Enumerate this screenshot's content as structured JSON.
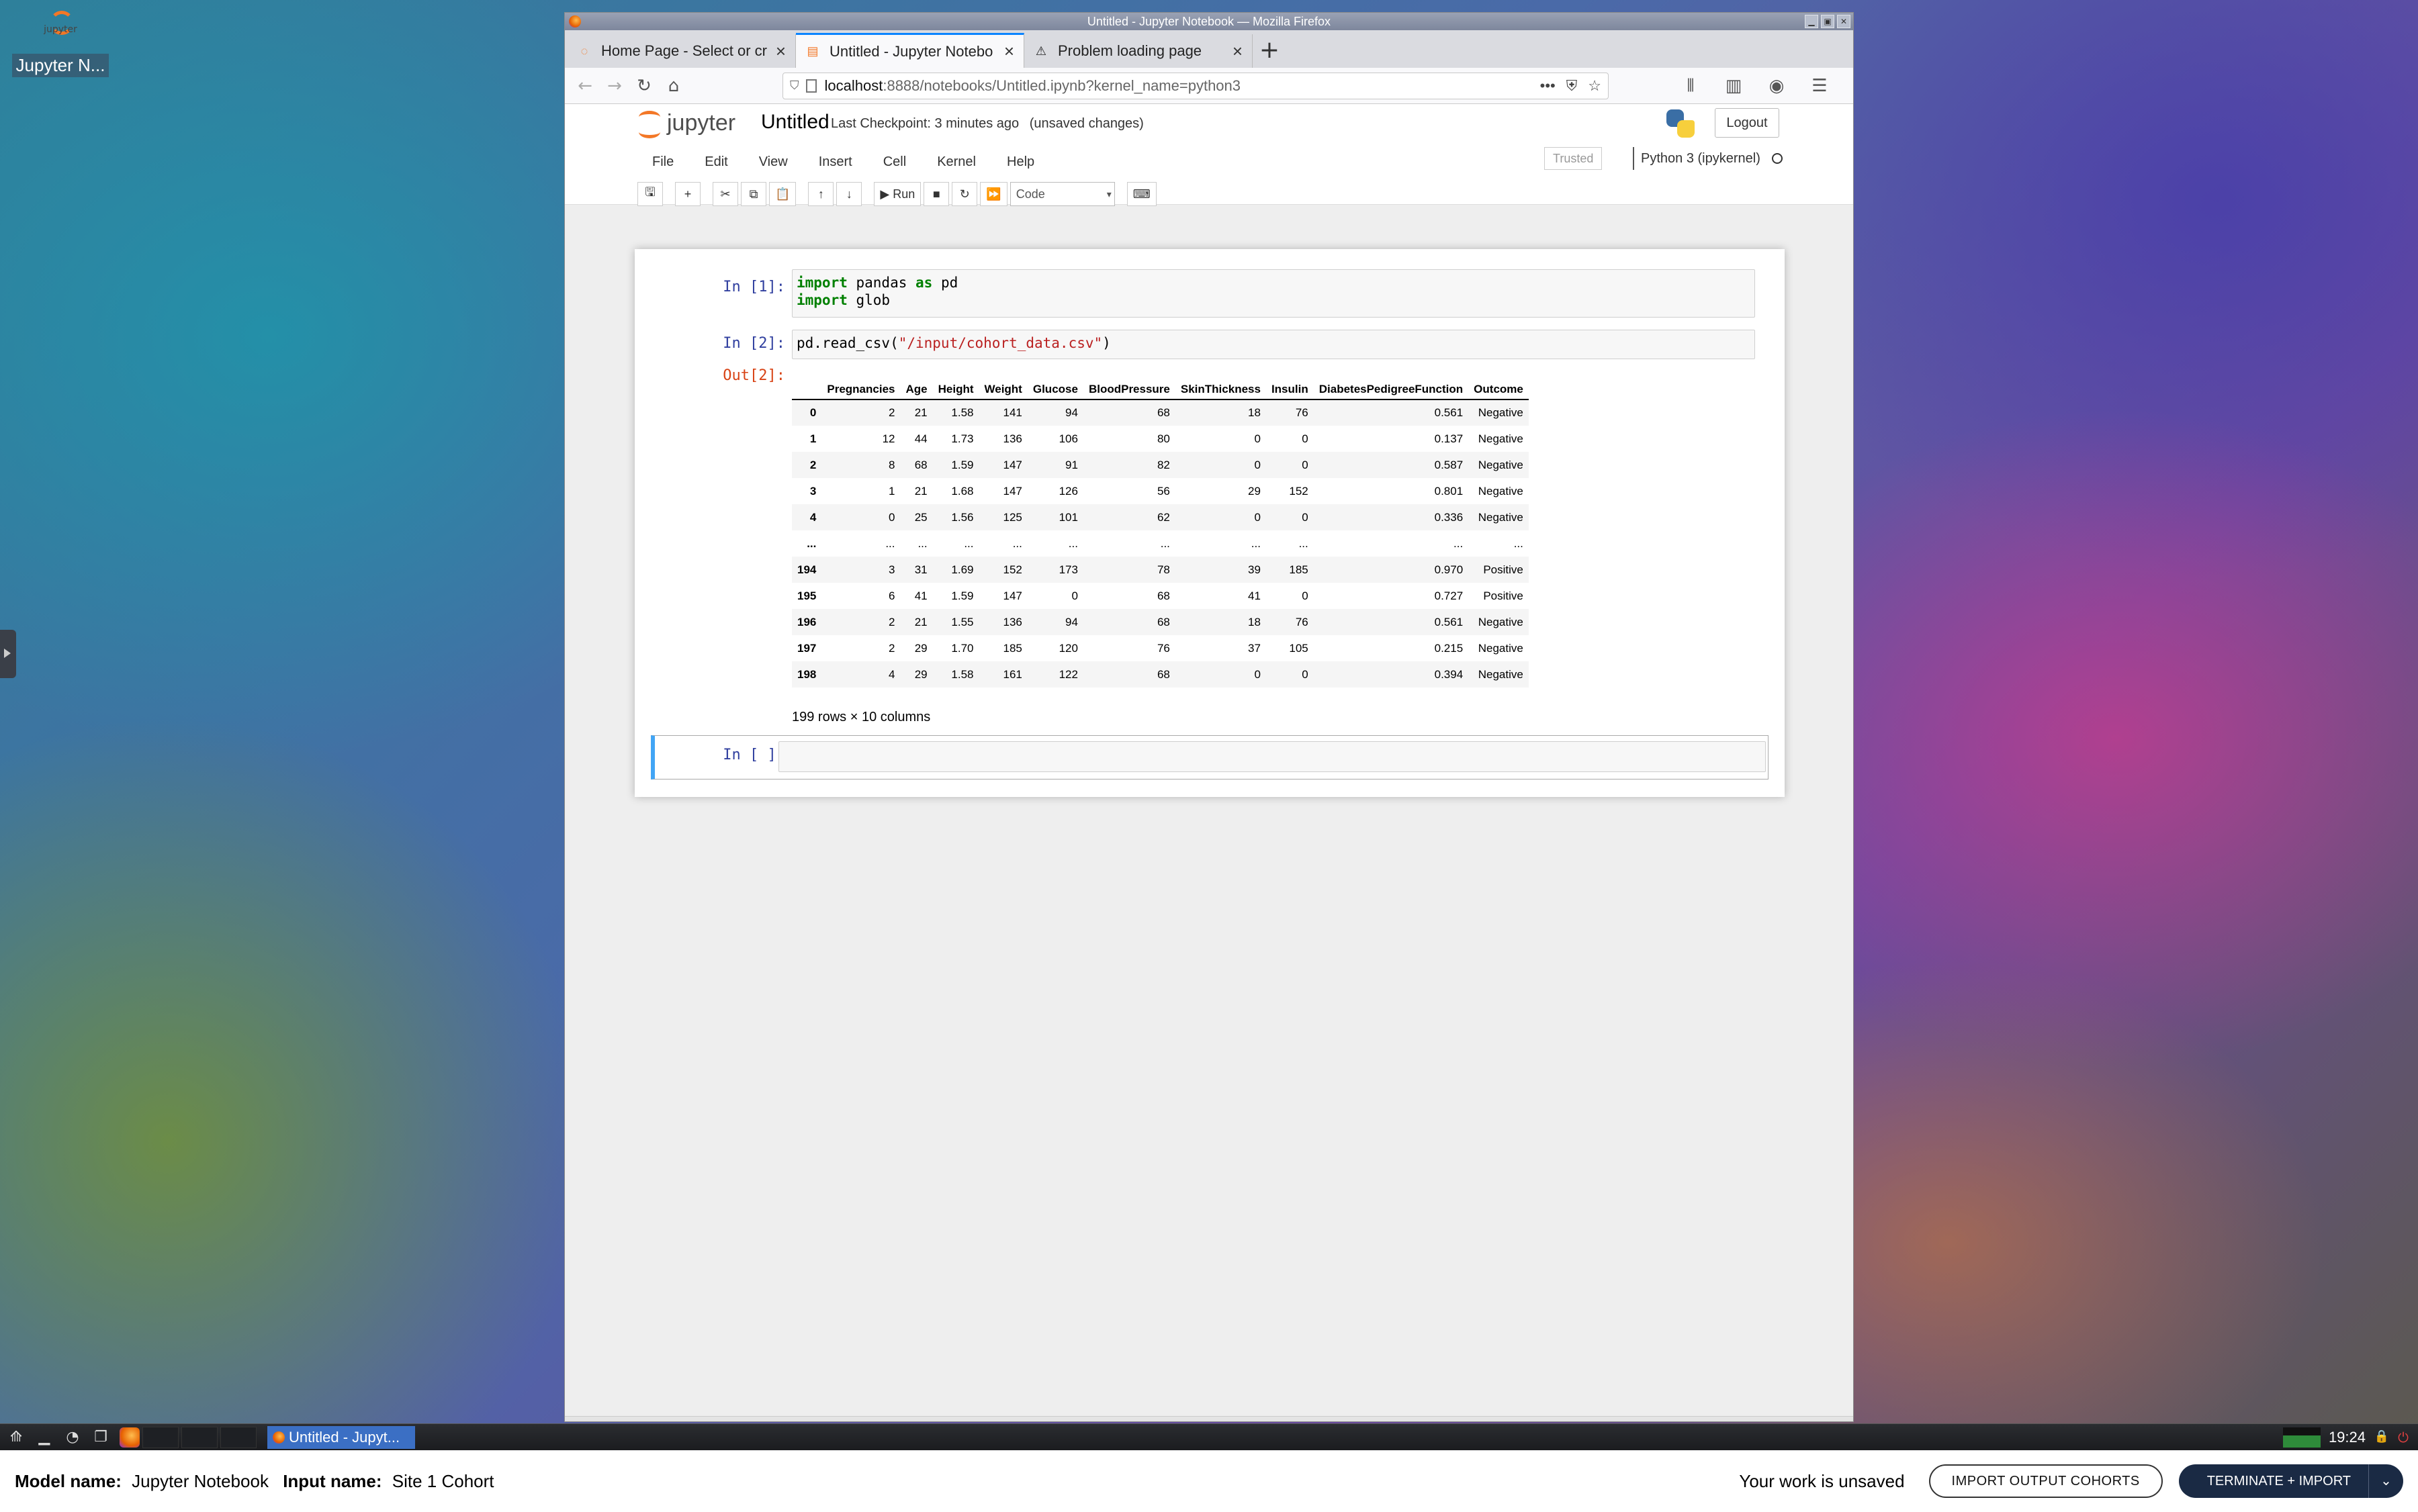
{
  "desktop": {
    "icon_label": "Jupyter N...",
    "icon_caption": "jupyter"
  },
  "window": {
    "title": "Untitled - Jupyter Notebook — Mozilla Firefox"
  },
  "tabs": [
    {
      "label": "Home Page - Select or cr",
      "icon": "jupyter-icon"
    },
    {
      "label": "Untitled - Jupyter Notebo",
      "icon": "jupyter-icon"
    },
    {
      "label": "Problem loading page",
      "icon": "warning-icon"
    }
  ],
  "url": {
    "host": "localhost",
    "path": ":8888/notebooks/Untitled.ipynb?kernel_name=python3"
  },
  "notebook": {
    "logo_text": "jupyter",
    "name": "Untitled",
    "checkpoint": "Last Checkpoint: 3 minutes ago",
    "unsaved": "(unsaved changes)",
    "logout": "Logout",
    "trusted": "Trusted",
    "kernel": "Python 3 (ipykernel)",
    "menu": [
      "File",
      "Edit",
      "View",
      "Insert",
      "Cell",
      "Kernel",
      "Help"
    ],
    "run_label": "Run",
    "cell_type": "Code"
  },
  "cells": {
    "c1_prompt": "In [1]:",
    "c2_prompt": "In [2]:",
    "c2_out_prompt": "Out[2]:",
    "c3_prompt": "In [ ]:",
    "c1_line1": [
      "import",
      " pandas ",
      "as",
      " pd"
    ],
    "c1_line2": [
      "import",
      " glob"
    ],
    "c2_code": [
      "pd.read_csv(",
      "\"/input/cohort_data.csv\"",
      ")"
    ]
  },
  "dataframe": {
    "columns": [
      "",
      "Pregnancies",
      "Age",
      "Height",
      "Weight",
      "Glucose",
      "BloodPressure",
      "SkinThickness",
      "Insulin",
      "DiabetesPedigreeFunction",
      "Outcome"
    ],
    "rows": [
      [
        "0",
        "2",
        "21",
        "1.58",
        "141",
        "94",
        "68",
        "18",
        "76",
        "0.561",
        "Negative"
      ],
      [
        "1",
        "12",
        "44",
        "1.73",
        "136",
        "106",
        "80",
        "0",
        "0",
        "0.137",
        "Negative"
      ],
      [
        "2",
        "8",
        "68",
        "1.59",
        "147",
        "91",
        "82",
        "0",
        "0",
        "0.587",
        "Negative"
      ],
      [
        "3",
        "1",
        "21",
        "1.68",
        "147",
        "126",
        "56",
        "29",
        "152",
        "0.801",
        "Negative"
      ],
      [
        "4",
        "0",
        "25",
        "1.56",
        "125",
        "101",
        "62",
        "0",
        "0",
        "0.336",
        "Negative"
      ],
      [
        "...",
        "...",
        "...",
        "...",
        "...",
        "...",
        "...",
        "...",
        "...",
        "...",
        "..."
      ],
      [
        "194",
        "3",
        "31",
        "1.69",
        "152",
        "173",
        "78",
        "39",
        "185",
        "0.970",
        "Positive"
      ],
      [
        "195",
        "6",
        "41",
        "1.59",
        "147",
        "0",
        "68",
        "41",
        "0",
        "0.727",
        "Positive"
      ],
      [
        "196",
        "2",
        "21",
        "1.55",
        "136",
        "94",
        "68",
        "18",
        "76",
        "0.561",
        "Negative"
      ],
      [
        "197",
        "2",
        "29",
        "1.70",
        "185",
        "120",
        "76",
        "37",
        "105",
        "0.215",
        "Negative"
      ],
      [
        "198",
        "4",
        "29",
        "1.58",
        "161",
        "122",
        "68",
        "0",
        "0",
        "0.394",
        "Negative"
      ]
    ],
    "summary": "199 rows × 10 columns"
  },
  "taskbar": {
    "task_label": "Untitled - Jupyt...",
    "clock": "19:24"
  },
  "bottom": {
    "model_label": "Model name:",
    "model_value": "Jupyter Notebook",
    "input_label": "Input name:",
    "input_value": "Site 1 Cohort",
    "unsaved": "Your work is unsaved",
    "import_btn": "IMPORT OUTPUT COHORTS",
    "terminate_btn": "TERMINATE + IMPORT"
  }
}
